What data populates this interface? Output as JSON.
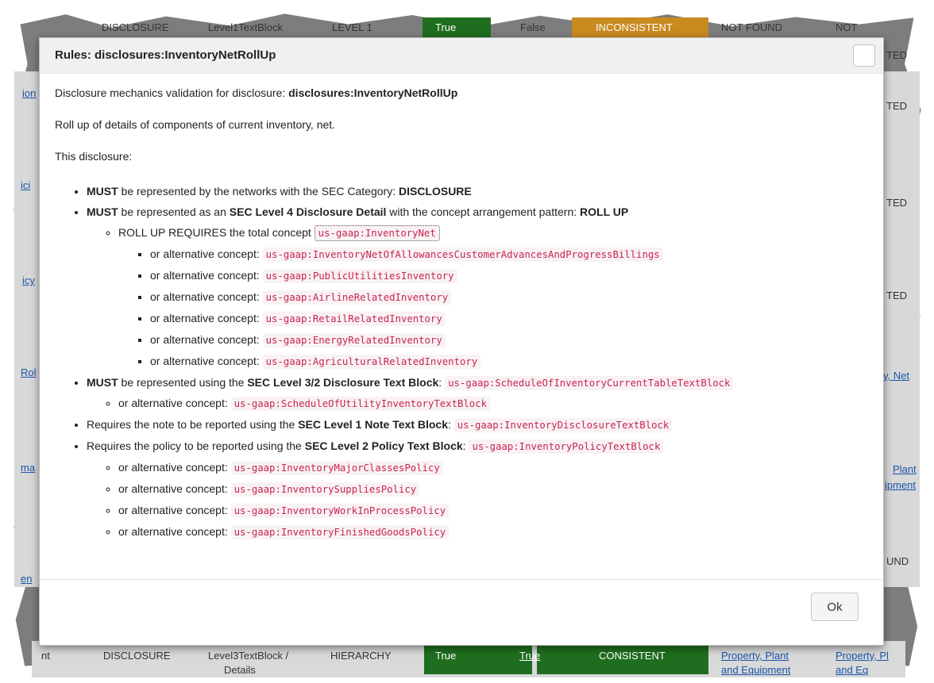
{
  "background": {
    "top_row": [
      "DISCLOSURE",
      "Level1TextBlock",
      "LEVEL 1",
      "True",
      "False",
      "INCONSISTENT",
      "NOT FOUND",
      "NOT"
    ],
    "right_fragments": [
      "TED",
      "TED",
      "TED",
      "TED",
      "y, Net",
      "Plant",
      "ipment",
      "UND"
    ],
    "left_fragments": [
      "ion",
      "ici",
      "icy",
      "Rol",
      "ma",
      "en"
    ],
    "bottom_row": [
      "nt",
      "DISCLOSURE",
      "Level3TextBlock /",
      "HIERARCHY",
      "True",
      "True",
      "CONSISTENT",
      "Property, Plant",
      "Property, Pl"
    ],
    "bottom_row_second_line": [
      "Details",
      "and Equipment",
      "and Eq"
    ]
  },
  "modal": {
    "title": "Rules: disclosures:InventoryNetRollUp",
    "intro_prefix": "Disclosure mechanics validation for disclosure: ",
    "intro_name": "disclosures:InventoryNetRollUp",
    "description": "Roll up of details of components of current inventory, net.",
    "this_disclosure": "This disclosure:",
    "rule1": {
      "bold": "MUST",
      "text": " be represented by the networks with the SEC Category: ",
      "value": "DISCLOSURE"
    },
    "rule2": {
      "bold": "MUST",
      "text1": " be represented as an ",
      "level": "SEC Level 4 Disclosure Detail",
      "text2": " with the concept arrangement pattern: ",
      "pattern": "ROLL UP"
    },
    "rollup": {
      "text": "ROLL UP REQUIRES the total concept ",
      "concept": "us-gaap:InventoryNet"
    },
    "alt_label": "or alternative concept:",
    "rollup_alternatives": [
      "us-gaap:InventoryNetOfAllowancesCustomerAdvancesAndProgressBillings",
      "us-gaap:PublicUtilitiesInventory",
      "us-gaap:AirlineRelatedInventory",
      "us-gaap:RetailRelatedInventory",
      "us-gaap:EnergyRelatedInventory",
      "us-gaap:AgriculturalRelatedInventory"
    ],
    "rule3": {
      "bold": "MUST",
      "text": " be represented using the ",
      "level": "SEC Level 3/2 Disclosure Text Block",
      "colon": ": ",
      "concept": "us-gaap:ScheduleOfInventoryCurrentTableTextBlock",
      "alternative": "us-gaap:ScheduleOfUtilityInventoryTextBlock"
    },
    "rule4": {
      "text": "Requires the note to be reported using the ",
      "level": "SEC Level 1 Note Text Block",
      "colon": ": ",
      "concept": "us-gaap:InventoryDisclosureTextBlock"
    },
    "rule5": {
      "text": "Requires the policy to be reported using the ",
      "level": "SEC Level 2 Policy Text Block",
      "colon": ": ",
      "concept": "us-gaap:InventoryPolicyTextBlock"
    },
    "policy_alternatives": [
      "us-gaap:InventoryMajorClassesPolicy",
      "us-gaap:InventorySuppliesPolicy",
      "us-gaap:InventoryWorkInProcessPolicy",
      "us-gaap:InventoryFinishedGoodsPolicy"
    ],
    "ok_label": "Ok"
  },
  "colors": {
    "code_text": "#c7254e",
    "code_bg": "#f9f2f4",
    "consistent": "#1f6e1f",
    "inconsistent": "#c98a20"
  }
}
